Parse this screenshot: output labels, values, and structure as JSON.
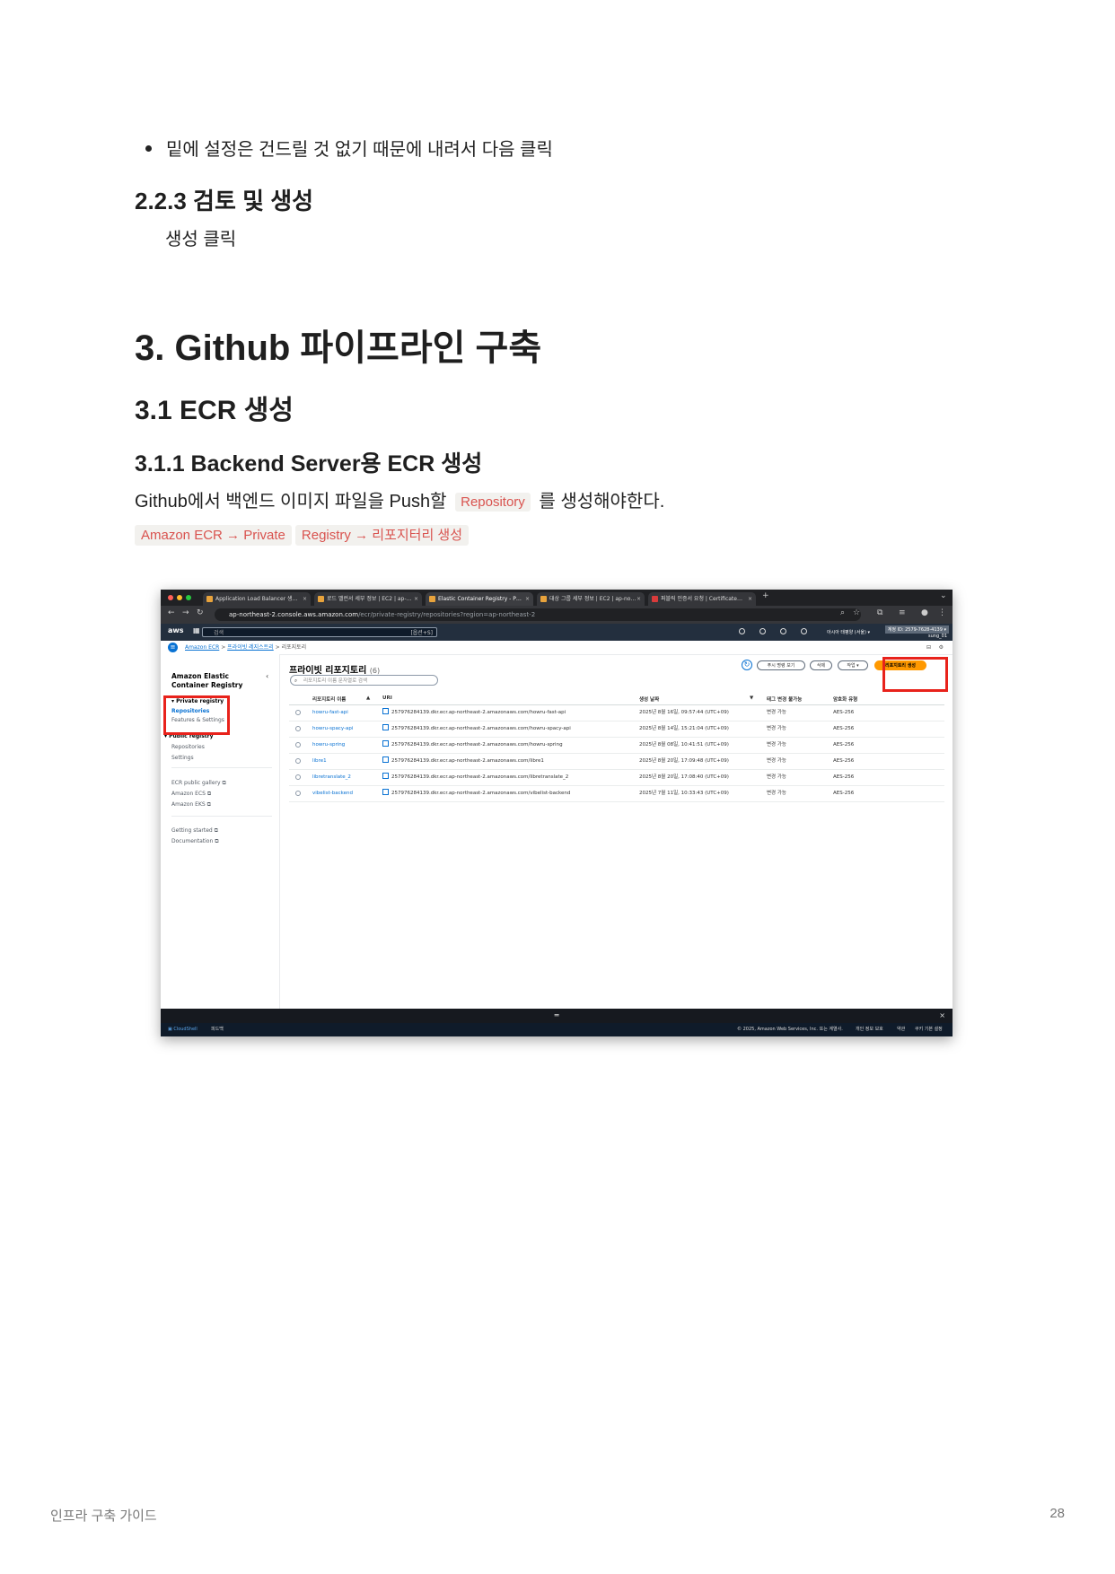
{
  "doc": {
    "bullet": "밑에 설정은 건드릴 것 없기 때문에 내려서 다음 클릭",
    "h_223": "2.2.3 검토 및 생성",
    "p_create": "생성 클릭",
    "h1": "3. Github 파이프라인 구축",
    "h2": "3.1 ECR 생성",
    "h3": "3.1.1 Backend Server용 ECR 생성",
    "para_before": "Github에서 백엔드 이미지 파일을 Push할 ",
    "para_code": "Repository",
    "para_after": " 를 생성해야한다.",
    "code_line_a": "Amazon ECR → Private",
    "code_line_b": "Registry → 리포지터리 생성",
    "footer_left": "인프라 구축 가이드",
    "footer_right": "28"
  },
  "screenshot": {
    "tabs": [
      "Application Load Balancer 생…",
      "로드 밸런서 세부 정보 | EC2 | ap-…",
      "Elastic Container Registry - P…",
      "대상 그룹 세부 정보 | EC2 | ap-no…",
      "퍼블릭 인증서 요청 | Certificate…"
    ],
    "url_host": "ap-northeast-2.console.aws.amazon.com",
    "url_path": "/ecr/private-registry/repositories?region=ap-northeast-2",
    "aws_logo": "aws",
    "search_placeholder": "검색",
    "search_shortcut": "[옵션+S]",
    "region": "아시아 태평양 (서울) ▾",
    "account_id": "계정 ID: 2579-7628-4139 ▾",
    "user": "sung_01",
    "breadcrumb_1": "Amazon ECR",
    "breadcrumb_2": "프라이빗 레지스트리",
    "breadcrumb_3": "리포지토리",
    "sidebar": {
      "title_1": "Amazon Elastic",
      "title_2": "Container Registry",
      "private_registry": "Private registry",
      "repositories": "Repositories",
      "features_settings": "Features & Settings",
      "public_registry": "Public registry",
      "public_repositories": "Repositories",
      "public_settings": "Settings",
      "ecr_gallery": "ECR public gallery",
      "amazon_ecs": "Amazon ECS",
      "amazon_eks": "Amazon EKS",
      "getting_started": "Getting started",
      "documentation": "Documentation"
    },
    "page_title": "프라이빗 리포지토리",
    "page_count": "(6)",
    "filter_placeholder": "리포지토리 이름 문자열로 검색",
    "btn_push": "푸시 명령 보기",
    "btn_delete": "삭제",
    "btn_actions": "작업 ▾",
    "btn_create": "리포지토리 생성",
    "columns": [
      "리포지토리 이름",
      "URI",
      "생성 날짜",
      "태그 변경 불가능",
      "암호화 유형"
    ],
    "rows": [
      {
        "name": "howru-fast-api",
        "uri": "257976284139.dkr.ecr.ap-northeast-2.amazonaws.com/howru-fast-api",
        "created": "2025년 8월 16일, 09:57:44 (UTC+09)",
        "immutable": "변경 가능",
        "enc": "AES-256"
      },
      {
        "name": "howru-spacy-api",
        "uri": "257976284139.dkr.ecr.ap-northeast-2.amazonaws.com/howru-spacy-api",
        "created": "2025년 8월 14일, 15:21:04 (UTC+09)",
        "immutable": "변경 가능",
        "enc": "AES-256"
      },
      {
        "name": "howru-spring",
        "uri": "257976284139.dkr.ecr.ap-northeast-2.amazonaws.com/howru-spring",
        "created": "2025년 8월 08일, 10:41:51 (UTC+09)",
        "immutable": "변경 가능",
        "enc": "AES-256"
      },
      {
        "name": "libre1",
        "uri": "257976284139.dkr.ecr.ap-northeast-2.amazonaws.com/libre1",
        "created": "2025년 8월 20일, 17:09:48 (UTC+09)",
        "immutable": "변경 가능",
        "enc": "AES-256"
      },
      {
        "name": "libretranslate_2",
        "uri": "257976284139.dkr.ecr.ap-northeast-2.amazonaws.com/libretranslate_2",
        "created": "2025년 8월 20일, 17:08:40 (UTC+09)",
        "immutable": "변경 가능",
        "enc": "AES-256"
      },
      {
        "name": "vibelist-backend",
        "uri": "257976284139.dkr.ecr.ap-northeast-2.amazonaws.com/vibelist-backend",
        "created": "2025년 7월 11일, 10:33:43 (UTC+09)",
        "immutable": "변경 가능",
        "enc": "AES-256"
      }
    ],
    "cloudshell": "CloudShell",
    "feedback": "피드백",
    "copyright": "© 2025, Amazon Web Services, Inc. 또는 계열사.",
    "privacy": "개인 정보 보호",
    "terms": "약관",
    "cookies": "쿠키 기본 설정"
  },
  "colors": {
    "code_text": "#d9534f",
    "highlight_box": "#e8221b",
    "aws_orange": "#ff9900",
    "aws_navy": "#232f3e",
    "link_blue": "#0972d3"
  }
}
